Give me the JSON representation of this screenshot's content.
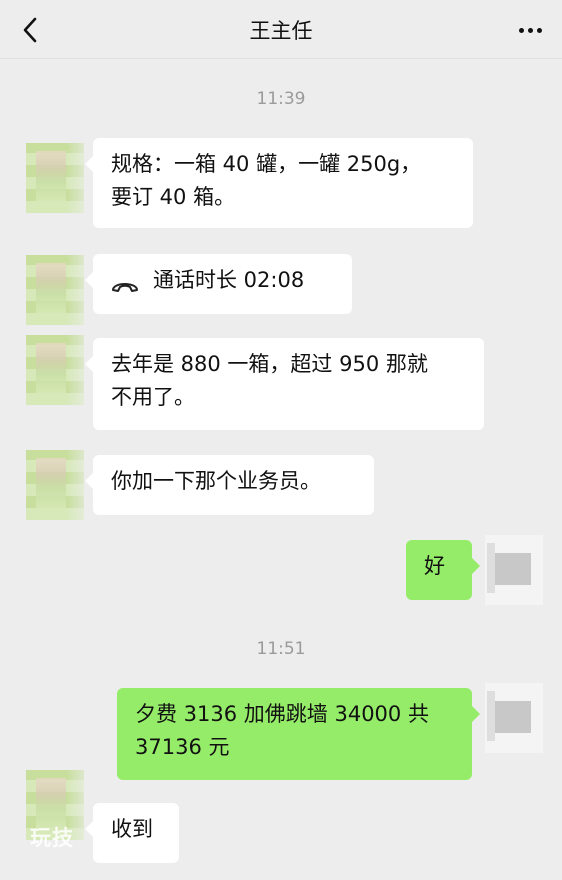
{
  "header": {
    "title": "王主任"
  },
  "timestamps": [
    "11:39",
    "11:51"
  ],
  "messages": [
    {
      "side": "left",
      "lines": [
        "规格：一箱 40 罐，一罐 250g，",
        "要订 40 箱。"
      ]
    },
    {
      "side": "left",
      "type": "call",
      "text": "通话时长 02:08"
    },
    {
      "side": "left",
      "lines": [
        "去年是 880 一箱，超过 950 那就",
        "不用了。"
      ]
    },
    {
      "side": "left",
      "lines": [
        "你加一下那个业务员。"
      ]
    },
    {
      "side": "right",
      "lines": [
        "好"
      ]
    },
    {
      "side": "right",
      "lines": [
        "夕费 3136 加佛跳墙 34000 共",
        "37136 元"
      ]
    },
    {
      "side": "left",
      "lines": [
        "收到"
      ]
    }
  ],
  "watermark": "玩技"
}
